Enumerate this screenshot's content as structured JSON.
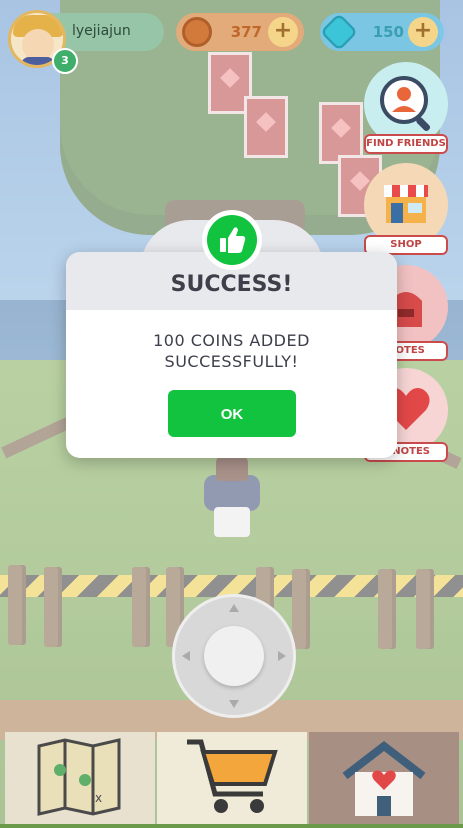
{
  "hud": {
    "username": "lyejiajun",
    "level": "3",
    "coins": "377",
    "gems": "150",
    "plus_label": "+"
  },
  "menu": [
    {
      "label": "FIND FRIENDS",
      "icon": "find-friends-icon"
    },
    {
      "label": "SHOP",
      "icon": "shop-icon"
    },
    {
      "label": "NOTES",
      "icon": "mailbox-icon"
    },
    {
      "label": "E NOTES",
      "icon": "heart-icon"
    }
  ],
  "modal": {
    "title": "SUCCESS!",
    "message_line1": "100 COINS ADDED",
    "message_line2": "SUCCESSFULLY!",
    "ok_label": "OK",
    "icon": "thumbs-up-icon",
    "accent_color": "#12c33f"
  },
  "bottom_bar": [
    {
      "icon": "map-icon"
    },
    {
      "icon": "shopping-cart-icon"
    },
    {
      "icon": "home-heart-icon"
    }
  ]
}
